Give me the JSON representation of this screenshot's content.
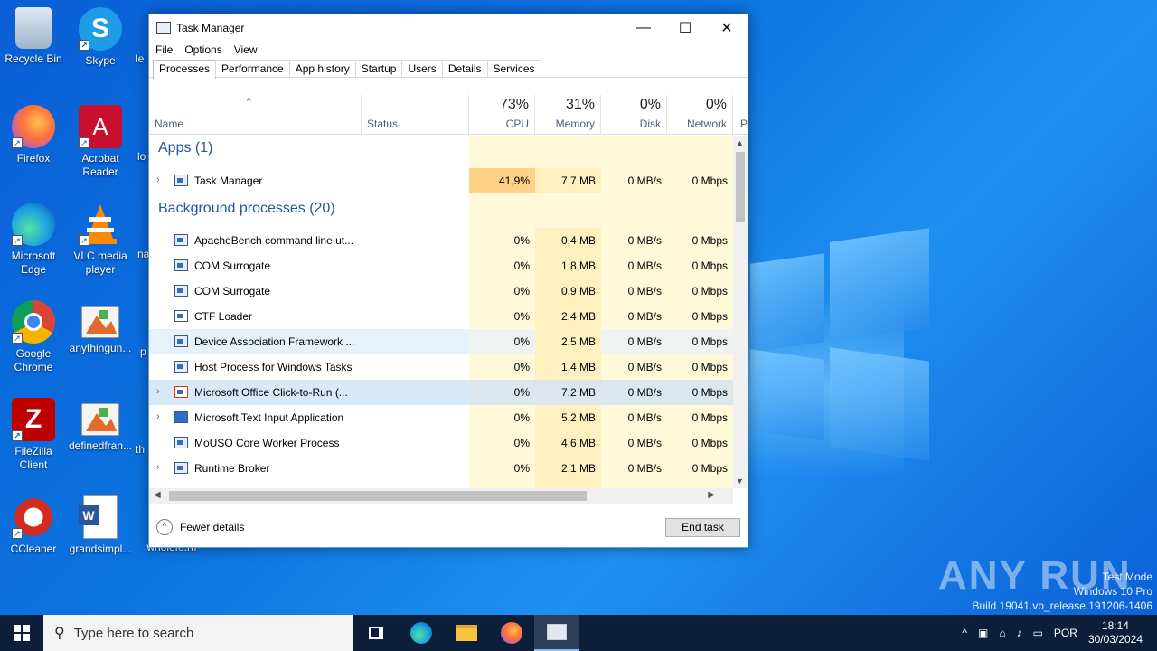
{
  "desktop": {
    "icons": [
      {
        "label": "Recycle Bin"
      },
      {
        "label": "Skype"
      },
      {
        "label": "Firefox"
      },
      {
        "label": "Acrobat Reader"
      },
      {
        "label": "Microsoft Edge"
      },
      {
        "label": "VLC media player"
      },
      {
        "label": "Google Chrome"
      },
      {
        "label": "anythingun..."
      },
      {
        "label": "FileZilla Client"
      },
      {
        "label": "definedfran..."
      },
      {
        "label": "CCleaner"
      },
      {
        "label": "grandsimpl..."
      }
    ],
    "partial_labels": [
      "le",
      "lo",
      "na",
      "p",
      "th",
      "wholefo.rtf"
    ]
  },
  "watermark": {
    "logo": "ANY RUN",
    "line1": "Test Mode",
    "line2": "Windows 10 Pro",
    "line3": "Build 19041.vb_release.191206-1406"
  },
  "window": {
    "title": "Task Manager",
    "controls": {
      "minimize": "—",
      "maximize": "☐",
      "close": "✕"
    },
    "menu": [
      "File",
      "Options",
      "View"
    ],
    "tabs": [
      "Processes",
      "Performance",
      "App history",
      "Startup",
      "Users",
      "Details",
      "Services"
    ],
    "columns": {
      "name": "Name",
      "status": "Status",
      "cpu": {
        "pct": "73%",
        "label": "CPU"
      },
      "memory": {
        "pct": "31%",
        "label": "Memory"
      },
      "disk": {
        "pct": "0%",
        "label": "Disk"
      },
      "network": {
        "pct": "0%",
        "label": "Network"
      },
      "power": "P"
    },
    "groups": {
      "apps": "Apps (1)",
      "background": "Background processes (20)"
    },
    "apps": [
      {
        "name": "Task Manager",
        "cpu": "41,9%",
        "memory": "7,7 MB",
        "disk": "0 MB/s",
        "network": "0 Mbps"
      }
    ],
    "processes": [
      {
        "name": "ApacheBench command line ut...",
        "cpu": "0%",
        "memory": "0,4 MB",
        "disk": "0 MB/s",
        "network": "0 Mbps"
      },
      {
        "name": "COM Surrogate",
        "cpu": "0%",
        "memory": "1,8 MB",
        "disk": "0 MB/s",
        "network": "0 Mbps"
      },
      {
        "name": "COM Surrogate",
        "cpu": "0%",
        "memory": "0,9 MB",
        "disk": "0 MB/s",
        "network": "0 Mbps"
      },
      {
        "name": "CTF Loader",
        "cpu": "0%",
        "memory": "2,4 MB",
        "disk": "0 MB/s",
        "network": "0 Mbps"
      },
      {
        "name": "Device Association Framework ...",
        "cpu": "0%",
        "memory": "2,5 MB",
        "disk": "0 MB/s",
        "network": "0 Mbps"
      },
      {
        "name": "Host Process for Windows Tasks",
        "cpu": "0%",
        "memory": "1,4 MB",
        "disk": "0 MB/s",
        "network": "0 Mbps"
      },
      {
        "name": "Microsoft Office Click-to-Run (...",
        "cpu": "0%",
        "memory": "7,2 MB",
        "disk": "0 MB/s",
        "network": "0 Mbps"
      },
      {
        "name": "Microsoft Text Input Application",
        "cpu": "0%",
        "memory": "5,2 MB",
        "disk": "0 MB/s",
        "network": "0 Mbps"
      },
      {
        "name": "MoUSO Core Worker Process",
        "cpu": "0%",
        "memory": "4,6 MB",
        "disk": "0 MB/s",
        "network": "0 Mbps"
      },
      {
        "name": "Runtime Broker",
        "cpu": "0%",
        "memory": "2,1 MB",
        "disk": "0 MB/s",
        "network": "0 Mbps"
      }
    ],
    "footer": {
      "fewer_details": "Fewer details",
      "end_task": "End task"
    }
  },
  "taskbar": {
    "search_placeholder": "Type here to search",
    "language": "POR",
    "time": "18:14",
    "date": "30/03/2024"
  }
}
